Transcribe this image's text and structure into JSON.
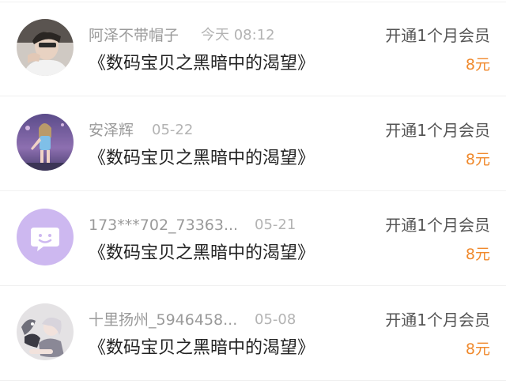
{
  "records": [
    {
      "username": "阿泽不带帽子",
      "time": "今天 08:12",
      "book": "《数码宝贝之黑暗中的渴望》",
      "plan": "开通1个月会员",
      "price": "8元",
      "avatar_icon": "user-photo-avatar"
    },
    {
      "username": "安泽辉",
      "time": "05-22",
      "book": "《数码宝贝之黑暗中的渴望》",
      "plan": "开通1个月会员",
      "price": "8元",
      "avatar_icon": "game-character-avatar"
    },
    {
      "username": "173***702_73363...",
      "time": "05-21",
      "book": "《数码宝贝之黑暗中的渴望》",
      "plan": "开通1个月会员",
      "price": "8元",
      "avatar_icon": "default-chat-bubble-avatar"
    },
    {
      "username": "十里扬州_5946458...",
      "time": "05-08",
      "book": "《数码宝贝之黑暗中的渴望》",
      "plan": "开通1个月会员",
      "price": "8元",
      "avatar_icon": "anime-illustration-avatar"
    }
  ],
  "colors": {
    "price": "#f0892c",
    "username": "#9a9a9a",
    "time": "#b3b3b3",
    "title": "#222222",
    "default_avatar_bg": "#cdb8f0"
  }
}
